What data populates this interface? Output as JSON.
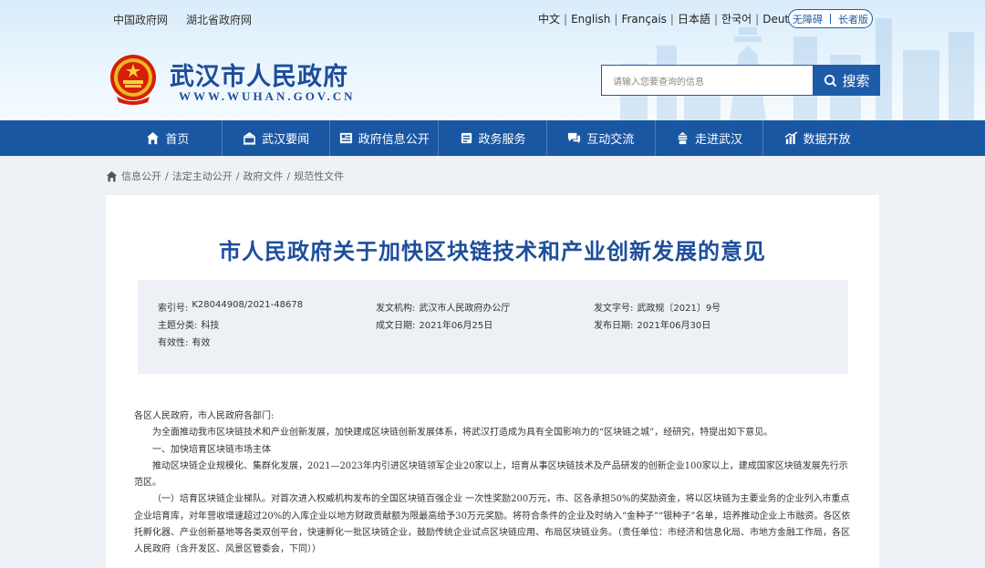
{
  "header": {
    "top_links": [
      "中国政府网",
      "湖北省政府网"
    ],
    "languages": [
      "中文",
      "English",
      "Français",
      "日本語",
      "한국어",
      "Deutsch"
    ],
    "accessibility": {
      "barrier_free": "无障碍",
      "elderly": "长者版"
    },
    "site_title": "武汉市人民政府",
    "site_url": "WWW.WUHAN.GOV.CN",
    "search_placeholder": "请输入您要查询的信息",
    "search_button": "搜索"
  },
  "nav": [
    {
      "label": "首页",
      "icon": "home-icon"
    },
    {
      "label": "武汉要闻",
      "icon": "news-icon"
    },
    {
      "label": "政府信息公开",
      "icon": "info-icon"
    },
    {
      "label": "政务服务",
      "icon": "service-icon"
    },
    {
      "label": "互动交流",
      "icon": "chat-icon"
    },
    {
      "label": "走进武汉",
      "icon": "building-icon"
    },
    {
      "label": "数据开放",
      "icon": "chart-icon"
    }
  ],
  "breadcrumb": [
    "信息公开",
    "法定主动公开",
    "政府文件",
    "规范性文件"
  ],
  "document": {
    "title": "市人民政府关于加快区块链技术和产业创新发展的意见",
    "meta": {
      "index_label": "索引号:",
      "index_value": "K28044908/2021-48678",
      "issuer_label": "发文机构:",
      "issuer_value": "武汉市人民政府办公厅",
      "docno_label": "发文字号:",
      "docno_value": "武政规〔2021〕9号",
      "topic_label": "主题分类:",
      "topic_value": "科技",
      "created_label": "成文日期:",
      "created_value": "2021年06月25日",
      "published_label": "发布日期:",
      "published_value": "2021年06月30日",
      "validity_label": "有效性:",
      "validity_value": "有效"
    },
    "paragraphs": [
      "各区人民政府，市人民政府各部门:",
      "为全面推动我市区块链技术和产业创新发展，加快建成区块链创新发展体系，将武汉打造成为具有全国影响力的“区块链之城”，经研究，特提出如下意见。",
      "一、加快培育区块链市场主体",
      "推动区块链企业规模化、集群化发展，2021—2023年内引进区块链领军企业20家以上，培育从事区块链技术及产品研发的创新企业100家以上，建成国家区块链发展先行示范区。",
      "（一）培育区块链企业梯队。对首次进入权威机构发布的全国区块链百强企业 一次性奖励200万元，市、区各承担50%的奖励资金，将以区块链为主要业务的企业列入市重点企业培育库，对年营收增速超过20%的入库企业以地方财政贡献额为限最高给予30万元奖励。将符合条件的企业及时纳入“金种子”“银种子”名单，培养推动企业上市融资。各区依托孵化器、产业创新基地等各类双创平台，快速孵化一批区块链企业，鼓励传统企业试点区块链应用、布局区块链业务。（责任单位：市经济和信息化局、市地方金融工作局，各区人民政府（含开发区、风景区管委会，下同））"
    ]
  }
}
